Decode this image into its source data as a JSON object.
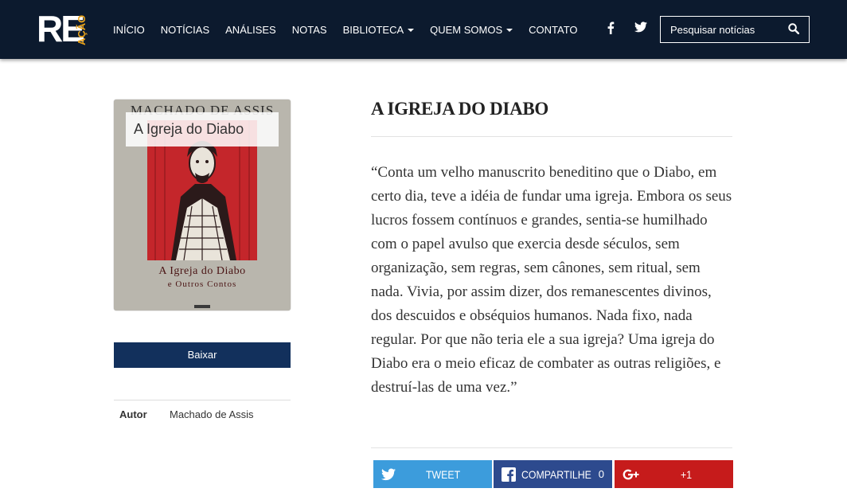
{
  "header": {
    "logo": {
      "main": "RE",
      "accent": "AÇÃO"
    },
    "nav": [
      {
        "label": "INÍCIO",
        "dropdown": false
      },
      {
        "label": "NOTÍCIAS",
        "dropdown": false
      },
      {
        "label": "ANÁLISES",
        "dropdown": false
      },
      {
        "label": "NOTAS",
        "dropdown": false
      },
      {
        "label": "BIBLIOTECA",
        "dropdown": true
      },
      {
        "label": "QUEM SOMOS",
        "dropdown": true
      },
      {
        "label": "CONTATO",
        "dropdown": false
      }
    ],
    "social": [
      "facebook-icon",
      "twitter-icon"
    ],
    "search": {
      "placeholder": "Pesquisar notícias",
      "value": ""
    }
  },
  "book": {
    "cover": {
      "author": "MACHADO DE ASSIS",
      "title_line1": "A Igreja do Diabo",
      "title_line2": "e Outros Contos",
      "label": "A Igreja do Diabo"
    },
    "download_label": "Baixar",
    "meta": {
      "author_key": "Autor",
      "author_value": "Machado de Assis"
    }
  },
  "article": {
    "title": "A IGREJA DO DIABO",
    "quote": "“Conta um velho manuscrito beneditino que o Diabo, em certo dia, teve a idéia de fundar uma igreja. Embora os seus lucros fossem contínuos e grandes, sentia-se humilhado com o papel avulso que exercia desde séculos, sem organização, sem regras, sem cânones, sem ritual, sem nada. Vivia, por assim dizer, dos remanescentes divinos, dos descuidos e obséquios humanos. Nada fixo, nada regular. Por que não teria ele a sua igreja? Uma igreja do Diabo era o meio eficaz de combater as outras religiões, e destruí-las de uma vez.”"
  },
  "share": {
    "twitter": {
      "label": "TWEET",
      "icon": "twitter-icon"
    },
    "facebook": {
      "label": "COMPARTILHE",
      "count": "0",
      "icon": "facebook-icon"
    },
    "google": {
      "label": "+1",
      "icon": "google-plus-icon"
    }
  },
  "colors": {
    "navbar": "#0c1a2e",
    "logo_accent": "#e8a21a",
    "download": "#12305c",
    "twitter": "#3c9cdc",
    "facebook": "#2d4a8e",
    "google": "#c61b1b"
  }
}
